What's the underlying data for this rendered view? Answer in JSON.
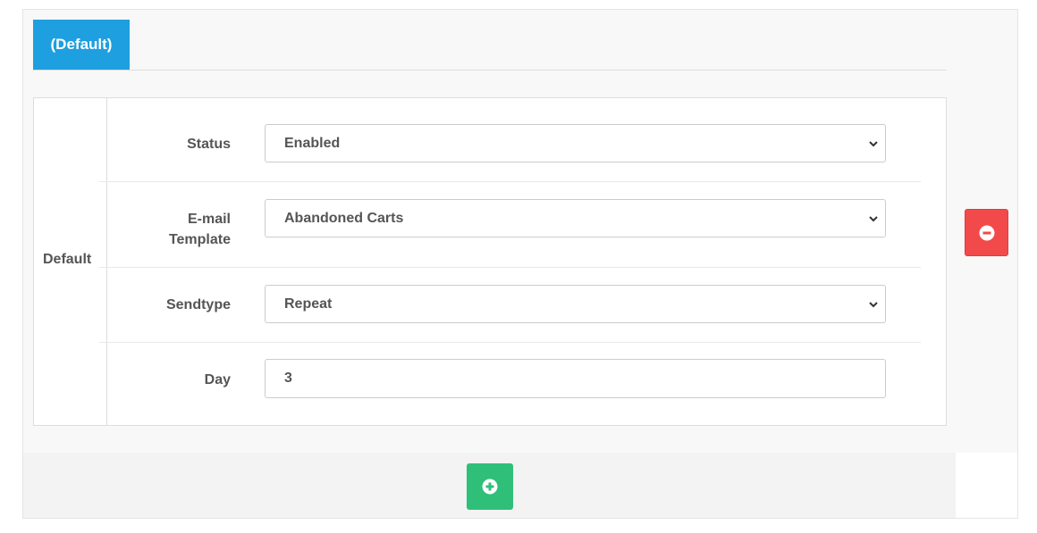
{
  "tabs": [
    {
      "label": "(Default)",
      "active": true
    }
  ],
  "group": {
    "label": "Default"
  },
  "fields": [
    {
      "label": "Status",
      "value": "Enabled",
      "type": "select"
    },
    {
      "label_line1": "E-mail",
      "label_line2": "Template",
      "value": "Abandoned Carts",
      "type": "select"
    },
    {
      "label": "Sendtype",
      "value": "Repeat",
      "type": "select"
    },
    {
      "label": "Day",
      "value": "3",
      "type": "text"
    }
  ],
  "icons": {
    "remove": "minus-circle-icon",
    "add": "plus-circle-icon",
    "select_arrow": "chevron-down-icon"
  },
  "colors": {
    "tab_active": "#1e9fe0",
    "remove_button": "#f24a4a",
    "add_button": "#2fbf79"
  }
}
